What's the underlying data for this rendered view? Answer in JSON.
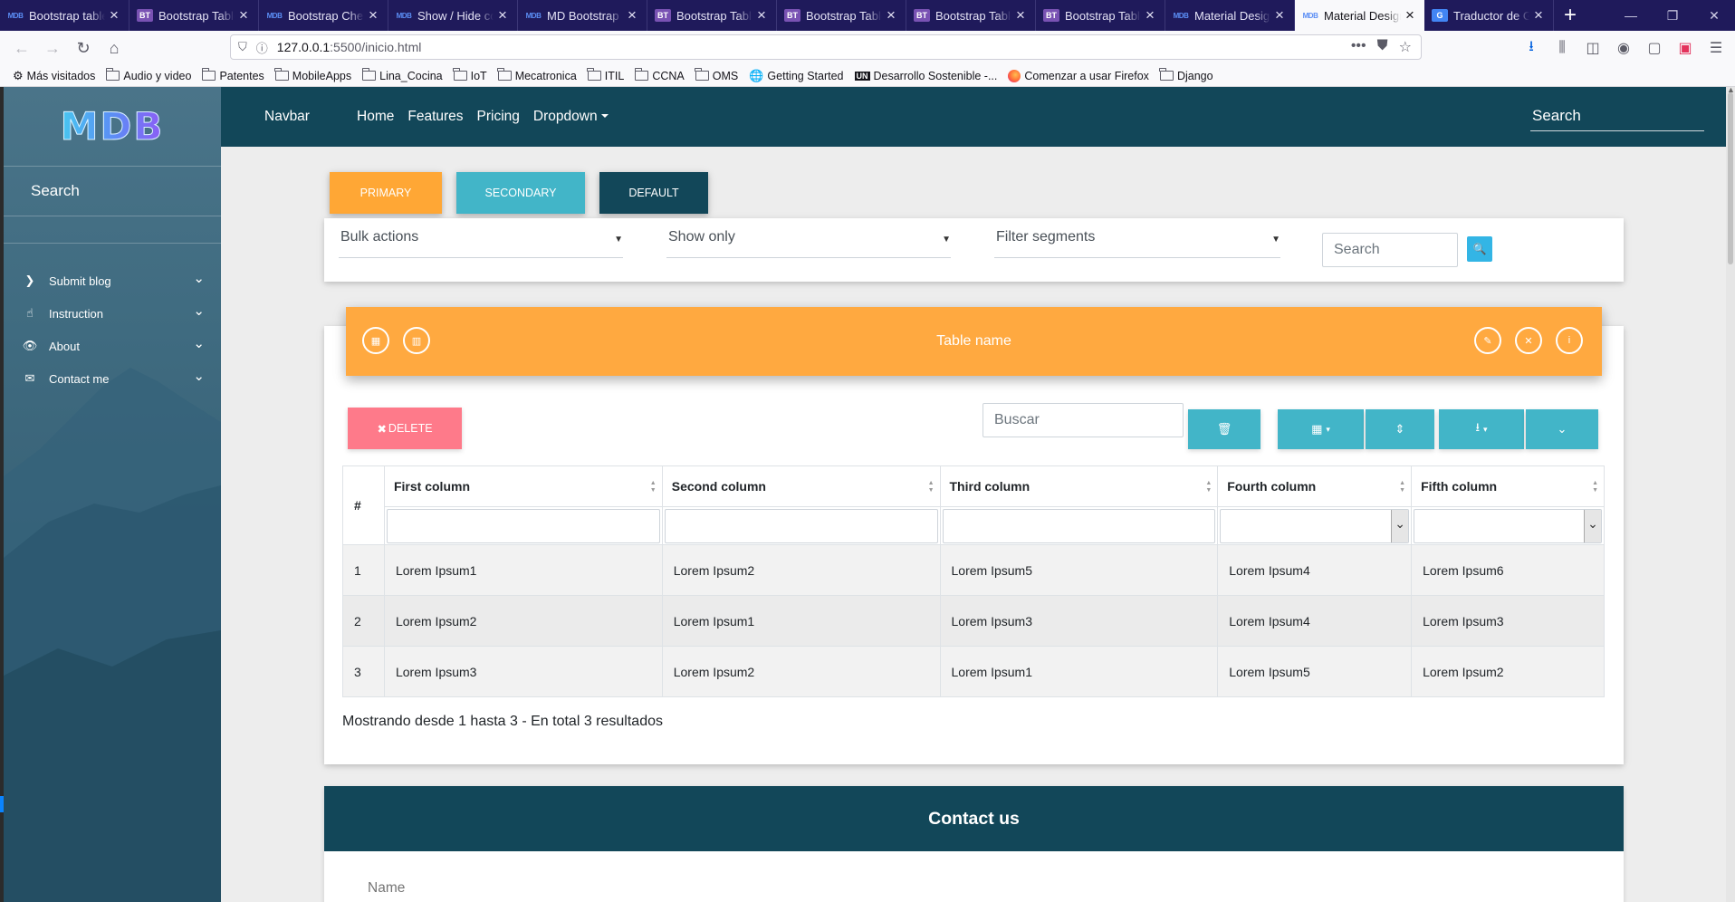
{
  "browser": {
    "tabs": [
      {
        "icon": "mdb",
        "title": "Bootstrap table"
      },
      {
        "icon": "bt",
        "title": "Bootstrap Table"
      },
      {
        "icon": "mdb",
        "title": "Bootstrap Checkbox"
      },
      {
        "icon": "mdb",
        "title": "Show / Hide columns"
      },
      {
        "icon": "mdb",
        "title": "MD Bootstrap"
      },
      {
        "icon": "bt",
        "title": "Bootstrap Table"
      },
      {
        "icon": "bt",
        "title": "Bootstrap Table"
      },
      {
        "icon": "bt",
        "title": "Bootstrap Table"
      },
      {
        "icon": "bt",
        "title": "Bootstrap Table"
      },
      {
        "icon": "mdb",
        "title": "Material Design"
      },
      {
        "icon": "mdb",
        "title": "Material Design",
        "active": true
      },
      {
        "icon": "gt",
        "title": "Traductor de Google"
      }
    ],
    "url_host": "127.0.0.1",
    "url_rest": ":5500/inicio.html",
    "bookmarks": [
      {
        "type": "gear",
        "label": "Más visitados"
      },
      {
        "type": "folder",
        "label": "Audio y video"
      },
      {
        "type": "folder",
        "label": "Patentes"
      },
      {
        "type": "folder",
        "label": "MobileApps"
      },
      {
        "type": "folder",
        "label": "Lina_Cocina"
      },
      {
        "type": "folder",
        "label": "IoT"
      },
      {
        "type": "folder",
        "label": "Mecatronica"
      },
      {
        "type": "folder",
        "label": "ITIL"
      },
      {
        "type": "folder",
        "label": "CCNA"
      },
      {
        "type": "folder",
        "label": "OMS"
      },
      {
        "type": "globe",
        "label": "Getting Started"
      },
      {
        "type": "un",
        "label": "Desarrollo Sostenible -..."
      },
      {
        "type": "firefox",
        "label": "Comenzar a usar Firefox"
      },
      {
        "type": "folder",
        "label": "Django"
      }
    ]
  },
  "sidebar": {
    "logo": "MDB",
    "search": "Search",
    "items": [
      {
        "icon": "chevron-right-icon",
        "glyph": "❯",
        "label": "Submit blog"
      },
      {
        "icon": "hand-pointer-icon",
        "glyph": "☝",
        "label": "Instruction"
      },
      {
        "icon": "eye-icon",
        "glyph": "👁",
        "label": "About"
      },
      {
        "icon": "envelope-icon",
        "glyph": "✉",
        "label": "Contact me"
      }
    ]
  },
  "topnav": {
    "brand": "Navbar",
    "links": [
      "Home",
      "Features",
      "Pricing",
      "Dropdown"
    ],
    "search": "Search"
  },
  "buttons": {
    "primary": "Primary",
    "secondary": "Secondary",
    "default": "Default"
  },
  "filters": {
    "bulk": "Bulk actions",
    "show": "Show only",
    "segments": "Filter segments",
    "search_placeholder": "Search"
  },
  "table": {
    "name": "Table name",
    "delete_label": "DELETE",
    "buscar_placeholder": "Buscar",
    "headers": [
      "#",
      "First column",
      "Second column",
      "Third column",
      "Fourth column",
      "Fifth column"
    ],
    "rows": [
      [
        "1",
        "Lorem Ipsum1",
        "Lorem Ipsum2",
        "Lorem Ipsum5",
        "Lorem Ipsum4",
        "Lorem Ipsum6"
      ],
      [
        "2",
        "Lorem Ipsum2",
        "Lorem Ipsum1",
        "Lorem Ipsum3",
        "Lorem Ipsum4",
        "Lorem Ipsum3"
      ],
      [
        "3",
        "Lorem Ipsum3",
        "Lorem Ipsum2",
        "Lorem Ipsum1",
        "Lorem Ipsum5",
        "Lorem Ipsum2"
      ]
    ],
    "info": "Mostrando desde 1 hasta 3 - En total 3 resultados"
  },
  "contact": {
    "title": "Contact us",
    "name_label": "Name"
  },
  "colors": {
    "primary": "#ffa735",
    "secondary": "#42b5c8",
    "navy": "#124759",
    "danger": "#fe7a8a",
    "info": "#33b5e5"
  }
}
